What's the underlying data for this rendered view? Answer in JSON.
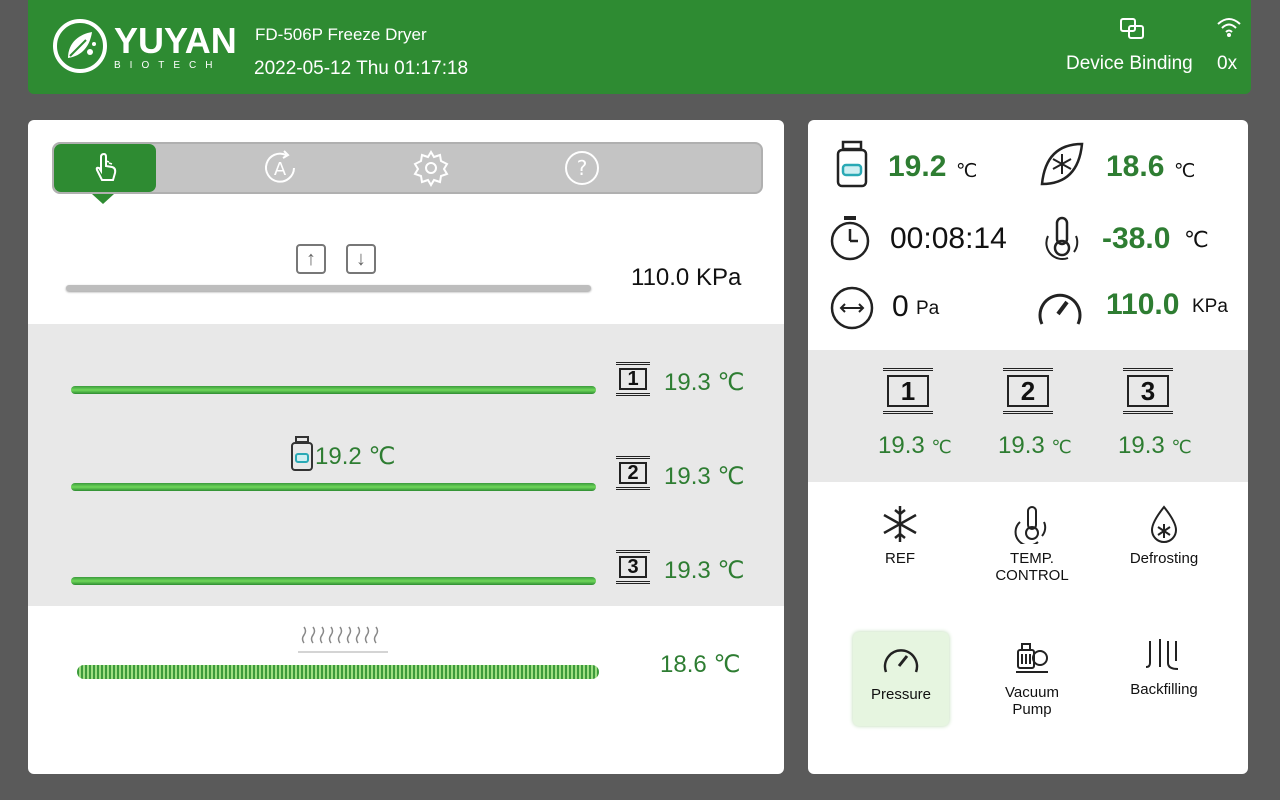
{
  "header": {
    "brand": "YUYAN",
    "brand_sub": "BIOTECH",
    "model": "FD-506P Freeze Dryer",
    "datetime": "2022-05-12 Thu 01:17:18",
    "device_binding_label": "Device Binding",
    "wifi_label": "0x",
    "accent_color": "#2e8b32"
  },
  "tabs": [
    {
      "icon": "hand-pointer-icon",
      "active": true
    },
    {
      "icon": "auto-mode-icon",
      "active": false
    },
    {
      "icon": "gear-icon",
      "active": false
    },
    {
      "icon": "help-icon",
      "active": false
    }
  ],
  "chamber": {
    "pressure": "110.0 KPa",
    "shelves": [
      {
        "num": "1",
        "temp": "19.3 ℃"
      },
      {
        "num": "2",
        "temp": "19.3 ℃"
      },
      {
        "num": "3",
        "temp": "19.3 ℃"
      }
    ],
    "vial_temp": "19.2 ℃",
    "condenser_temp": "18.6 ℃"
  },
  "status": {
    "vial_temp": "19.2",
    "vial_unit": "℃",
    "condenser_temp": "18.6",
    "condenser_unit": "℃",
    "timer": "00:08:14",
    "temp_control": "-38.0",
    "temp_control_unit": "℃",
    "vacuum": "0",
    "vacuum_unit": "Pa",
    "pressure": "110.0",
    "pressure_unit": "KPa"
  },
  "right_shelves": [
    {
      "num": "1",
      "temp": "19.3",
      "unit": "℃"
    },
    {
      "num": "2",
      "temp": "19.3",
      "unit": "℃"
    },
    {
      "num": "3",
      "temp": "19.3",
      "unit": "℃"
    }
  ],
  "controls": [
    {
      "label": "REF",
      "icon": "snowflake-icon"
    },
    {
      "label": "TEMP. CONTROL",
      "icon": "thermometer-icon"
    },
    {
      "label": "Defrosting",
      "icon": "defrost-drop-icon"
    },
    {
      "label": "Pressure",
      "icon": "gauge-icon",
      "active": true
    },
    {
      "label": "Vacuum Pump",
      "icon": "vacuum-pump-icon"
    },
    {
      "label": "Backfilling",
      "icon": "backfill-valve-icon"
    }
  ]
}
